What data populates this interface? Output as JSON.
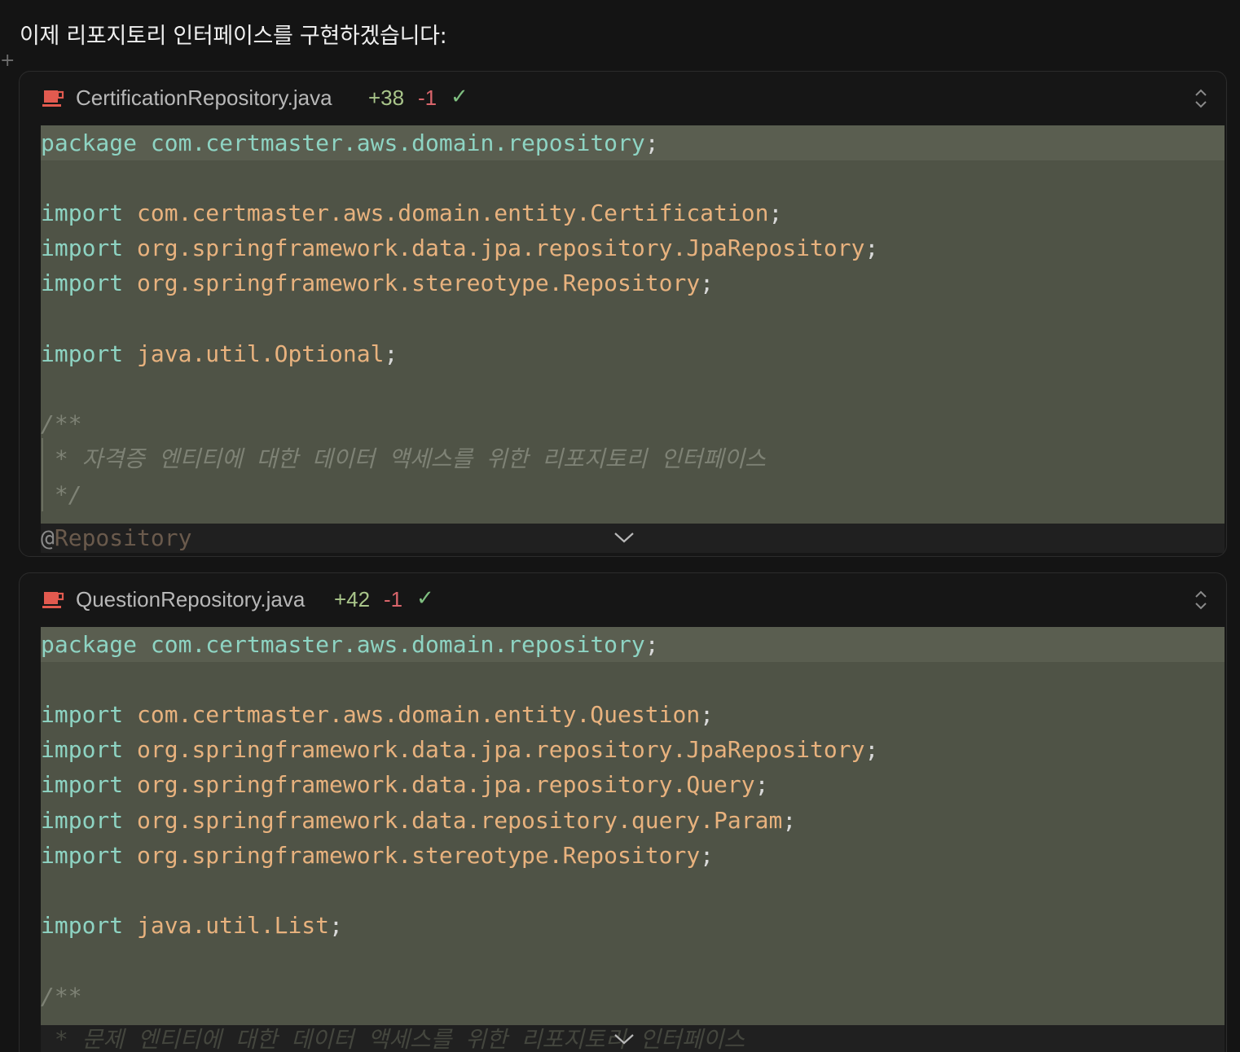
{
  "message": {
    "intro": "이제 리포지토리 인터페이스를 구현하겠습니다:",
    "add_mark": "+"
  },
  "files": [
    {
      "icon": "java-icon",
      "name": "CertificationRepository.java",
      "added": "+38",
      "removed": "-1",
      "status": "✓",
      "code_lines": [
        "package com.certmaster.aws.domain.repository;",
        "",
        "import com.certmaster.aws.domain.entity.Certification;",
        "import org.springframework.data.jpa.repository.JpaRepository;",
        "import org.springframework.stereotype.Repository;",
        "",
        "import java.util.Optional;",
        "",
        "/**",
        " * 자격증 엔티티에 대한 데이터 액세스를 위한 리포지토리 인터페이스",
        " */",
        "@Repository"
      ]
    },
    {
      "icon": "java-icon",
      "name": "QuestionRepository.java",
      "added": "+42",
      "removed": "-1",
      "status": "✓",
      "code_lines": [
        "package com.certmaster.aws.domain.repository;",
        "",
        "import com.certmaster.aws.domain.entity.Question;",
        "import org.springframework.data.jpa.repository.JpaRepository;",
        "import org.springframework.data.jpa.repository.Query;",
        "import org.springframework.data.repository.query.Param;",
        "import org.springframework.stereotype.Repository;",
        "",
        "import java.util.List;",
        "",
        "/**",
        " * 문제 엔티티에 대한 데이터 액세스를 위한 리포지토리 인터페이스"
      ]
    }
  ],
  "colors": {
    "keyword": "#8ed4c3",
    "type": "#e8b27e",
    "added": "#a9c58a",
    "removed": "#d9656b",
    "diff_background": "#4f5346"
  }
}
